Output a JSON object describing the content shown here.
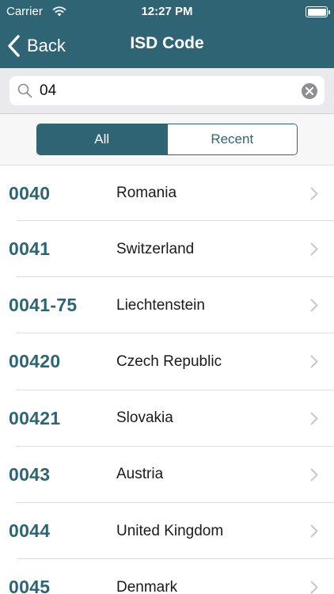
{
  "status_bar": {
    "carrier": "Carrier",
    "time": "12:27 PM"
  },
  "nav": {
    "back_label": "Back",
    "title": "ISD Code"
  },
  "search": {
    "value": "04",
    "placeholder": ""
  },
  "segments": [
    {
      "label": "All",
      "selected": true
    },
    {
      "label": "Recent",
      "selected": false
    }
  ],
  "rows": [
    {
      "code": "0040",
      "country": "Romania"
    },
    {
      "code": "0041",
      "country": "Switzerland"
    },
    {
      "code": "0041-75",
      "country": "Liechtenstein"
    },
    {
      "code": "00420",
      "country": "Czech Republic"
    },
    {
      "code": "00421",
      "country": "Slovakia"
    },
    {
      "code": "0043",
      "country": "Austria"
    },
    {
      "code": "0044",
      "country": "United Kingdom"
    },
    {
      "code": "0045",
      "country": "Denmark"
    }
  ],
  "icons": {
    "wifi": "wifi-icon",
    "battery": "battery-icon",
    "back": "chevron-left-icon",
    "search": "search-icon",
    "clear": "clear-icon",
    "row_disclosure": "chevron-right-icon"
  },
  "colors": {
    "brand": "#2f6475",
    "background": "#ffffff",
    "search_bar_bg": "#e9e9ee",
    "chevron": "#c7c7cc"
  }
}
